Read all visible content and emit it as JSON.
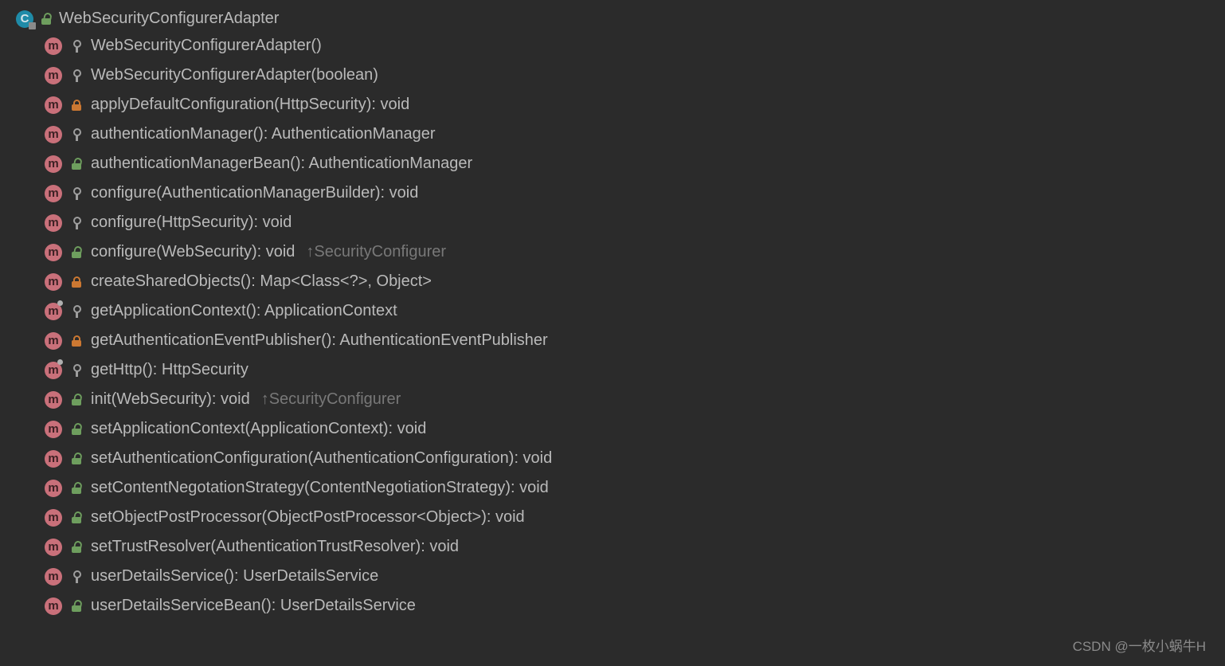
{
  "root": {
    "label": "WebSecurityConfigurerAdapter",
    "iconLetter": "C"
  },
  "watermark": "CSDN @一枚小蜗牛H",
  "overrideArrow": "↑",
  "items": [
    {
      "label": "WebSecurityConfigurerAdapter()",
      "visibility": "protected",
      "final": false,
      "override": ""
    },
    {
      "label": "WebSecurityConfigurerAdapter(boolean)",
      "visibility": "protected",
      "final": false,
      "override": ""
    },
    {
      "label": "applyDefaultConfiguration(HttpSecurity): void",
      "visibility": "private",
      "final": false,
      "override": ""
    },
    {
      "label": "authenticationManager(): AuthenticationManager",
      "visibility": "protected",
      "final": false,
      "override": ""
    },
    {
      "label": "authenticationManagerBean(): AuthenticationManager",
      "visibility": "public",
      "final": false,
      "override": ""
    },
    {
      "label": "configure(AuthenticationManagerBuilder): void",
      "visibility": "protected",
      "final": false,
      "override": ""
    },
    {
      "label": "configure(HttpSecurity): void",
      "visibility": "protected",
      "final": false,
      "override": ""
    },
    {
      "label": "configure(WebSecurity): void",
      "visibility": "public",
      "final": false,
      "override": "SecurityConfigurer"
    },
    {
      "label": "createSharedObjects(): Map<Class<?>, Object>",
      "visibility": "private",
      "final": false,
      "override": ""
    },
    {
      "label": "getApplicationContext(): ApplicationContext",
      "visibility": "protected",
      "final": true,
      "override": ""
    },
    {
      "label": "getAuthenticationEventPublisher(): AuthenticationEventPublisher",
      "visibility": "private",
      "final": false,
      "override": ""
    },
    {
      "label": "getHttp(): HttpSecurity",
      "visibility": "protected",
      "final": true,
      "override": ""
    },
    {
      "label": "init(WebSecurity): void",
      "visibility": "public",
      "final": false,
      "override": "SecurityConfigurer"
    },
    {
      "label": "setApplicationContext(ApplicationContext): void",
      "visibility": "public",
      "final": false,
      "override": ""
    },
    {
      "label": "setAuthenticationConfiguration(AuthenticationConfiguration): void",
      "visibility": "public",
      "final": false,
      "override": ""
    },
    {
      "label": "setContentNegotationStrategy(ContentNegotiationStrategy): void",
      "visibility": "public",
      "final": false,
      "override": ""
    },
    {
      "label": "setObjectPostProcessor(ObjectPostProcessor<Object>): void",
      "visibility": "public",
      "final": false,
      "override": ""
    },
    {
      "label": "setTrustResolver(AuthenticationTrustResolver): void",
      "visibility": "public",
      "final": false,
      "override": ""
    },
    {
      "label": "userDetailsService(): UserDetailsService",
      "visibility": "protected",
      "final": false,
      "override": ""
    },
    {
      "label": "userDetailsServiceBean(): UserDetailsService",
      "visibility": "public",
      "final": false,
      "override": ""
    }
  ]
}
